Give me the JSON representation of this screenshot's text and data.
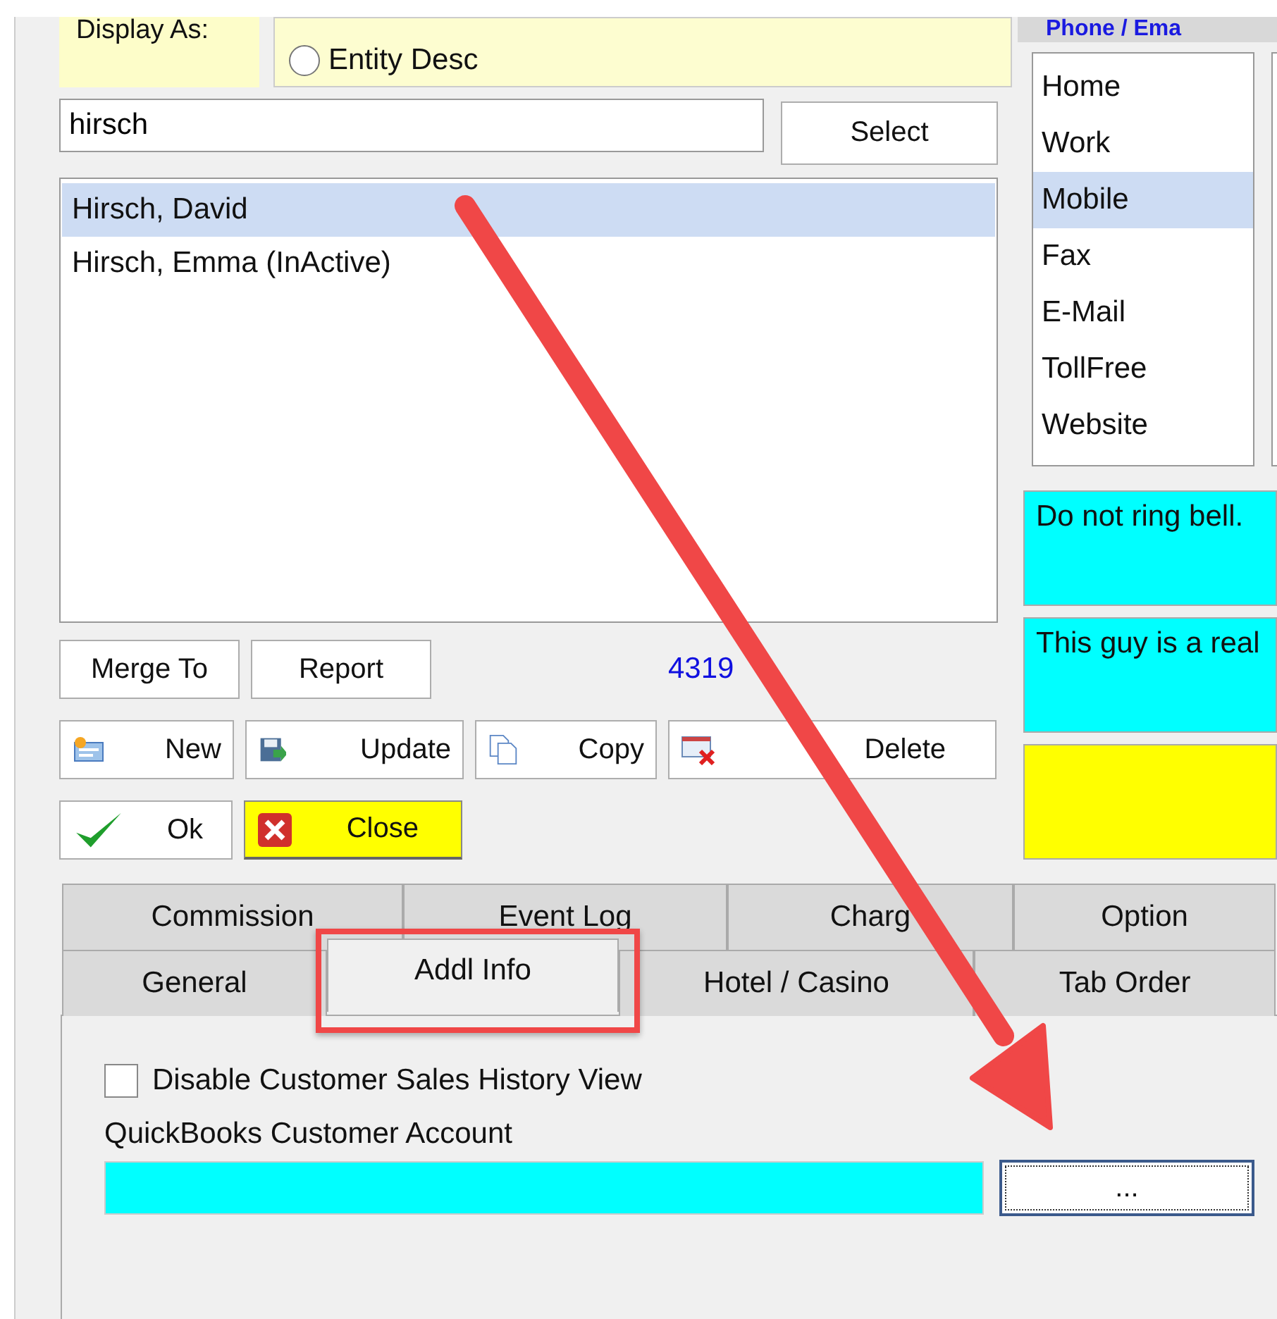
{
  "display_as": {
    "label": "Display As:",
    "options": [
      {
        "label": "Entity Desc",
        "selected": false
      }
    ]
  },
  "search": {
    "value": "hirsch"
  },
  "select_button": "Select",
  "results": [
    {
      "label": "Hirsch, David",
      "selected": true
    },
    {
      "label": "Hirsch, Emma (InActive)",
      "selected": false
    }
  ],
  "button_rows": [
    [
      {
        "label": "Merge To",
        "kind": "plain"
      },
      {
        "label": "Report",
        "kind": "plain"
      }
    ],
    [
      {
        "label": "New",
        "kind": "new"
      },
      {
        "label": "Update",
        "kind": "update"
      },
      {
        "label": "Copy",
        "kind": "copy"
      },
      {
        "label": "Delete",
        "kind": "delete"
      }
    ],
    [
      {
        "label": "Ok",
        "kind": "ok"
      },
      {
        "label": "Close",
        "kind": "close"
      }
    ]
  ],
  "record_number": "4319",
  "phone_panel": {
    "title": "Phone / Ema",
    "types": [
      {
        "label": "Home",
        "selected": false
      },
      {
        "label": "Work",
        "selected": false
      },
      {
        "label": "Mobile",
        "selected": true
      },
      {
        "label": "Fax",
        "selected": false
      },
      {
        "label": "E-Mail",
        "selected": false
      },
      {
        "label": "TollFree",
        "selected": false
      },
      {
        "label": "Website",
        "selected": false
      }
    ]
  },
  "notes": [
    {
      "text": "Do not ring bell.",
      "color": "#00ffff"
    },
    {
      "text": "This guy is a real",
      "color": "#00ffff"
    },
    {
      "color": "#ffff00"
    }
  ],
  "tab_rows": [
    [
      {
        "label": "Commission",
        "selected": false
      },
      {
        "label": "Event Log",
        "selected": false
      },
      {
        "label": "Charg",
        "selected": false
      },
      {
        "label": "Option",
        "selected": false
      }
    ],
    [
      {
        "label": "General",
        "selected": false
      },
      {
        "label": "Addl Info",
        "selected": true
      },
      {
        "label": "Hotel / Casino",
        "selected": false
      },
      {
        "label": "Tab Order",
        "selected": false
      }
    ]
  ],
  "addl_info": {
    "checkbox": {
      "label": "Disable Customer Sales History View",
      "checked": false
    },
    "field_label": "QuickBooks Customer Account",
    "browse_button": "..."
  },
  "annotations": {
    "arrow": true,
    "highlight_box": true
  }
}
